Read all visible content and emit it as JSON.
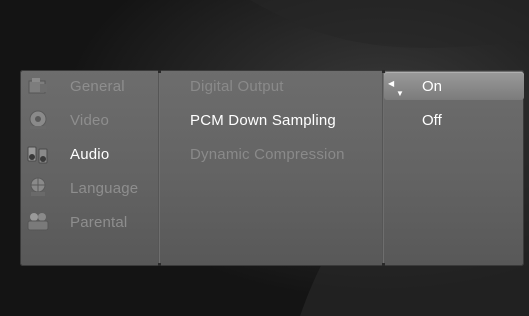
{
  "categories": [
    {
      "label": "General",
      "icon": "general-icon",
      "active": false
    },
    {
      "label": "Video",
      "icon": "video-icon",
      "active": false
    },
    {
      "label": "Audio",
      "icon": "audio-icon",
      "active": true
    },
    {
      "label": "Language",
      "icon": "language-icon",
      "active": false
    },
    {
      "label": "Parental",
      "icon": "parental-icon",
      "active": false
    }
  ],
  "options": [
    {
      "label": "Digital Output",
      "selected": false
    },
    {
      "label": "PCM Down Sampling",
      "selected": true
    },
    {
      "label": "Dynamic Compression",
      "selected": false
    }
  ],
  "values": [
    {
      "label": "On",
      "highlighted": true
    },
    {
      "label": "Off",
      "highlighted": false
    }
  ],
  "colors": {
    "active_text": "#ffffff",
    "inactive_text": "#8e8e8e",
    "panel": "#666666",
    "highlight": "#8a8a8a"
  }
}
